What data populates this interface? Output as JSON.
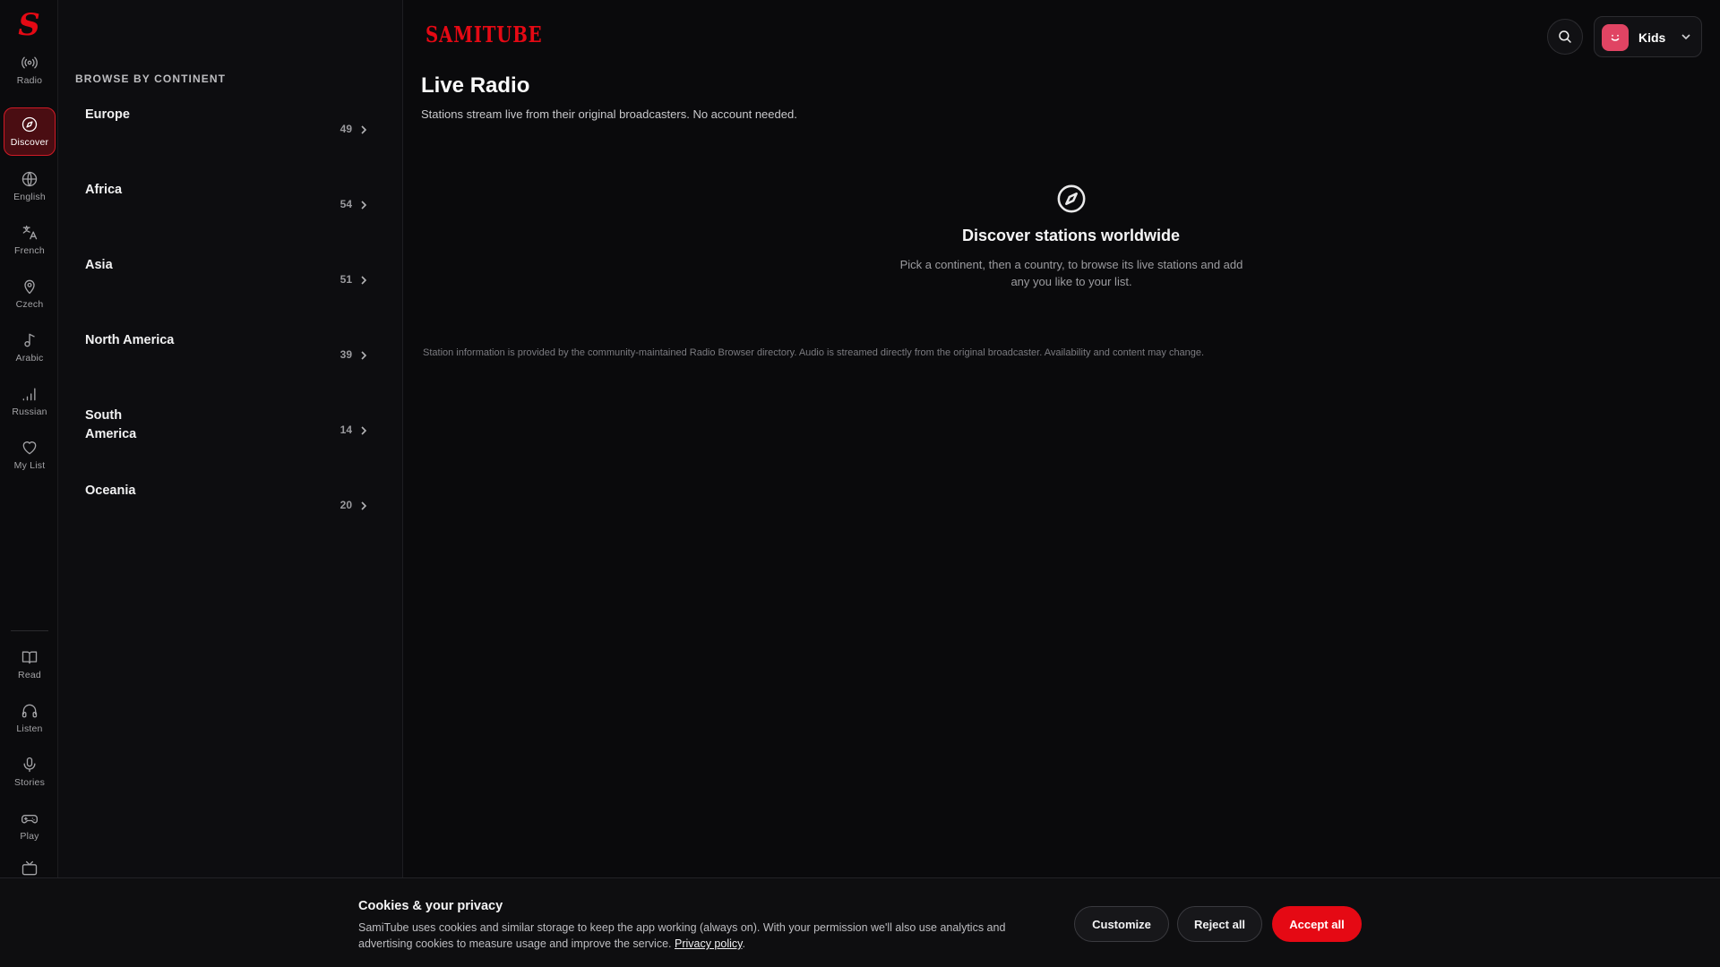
{
  "rail": {
    "logo": "S",
    "items": [
      {
        "label": "Radio",
        "icon": "radio-broadcast-icon"
      },
      {
        "label": "Discover",
        "icon": "compass-icon"
      },
      {
        "label": "English",
        "icon": "globe-icon"
      },
      {
        "label": "French",
        "icon": "translate-icon"
      },
      {
        "label": "Czech",
        "icon": "map-pin-icon"
      },
      {
        "label": "Arabic",
        "icon": "music-note-icon"
      },
      {
        "label": "Russian",
        "icon": "signal-bars-icon"
      },
      {
        "label": "My List",
        "icon": "heart-icon"
      },
      {
        "label": "Read",
        "icon": "book-icon"
      },
      {
        "label": "Listen",
        "icon": "headphones-icon"
      },
      {
        "label": "Stories",
        "icon": "microphone-icon"
      },
      {
        "label": "Play",
        "icon": "gamepad-icon"
      }
    ],
    "active": "Discover"
  },
  "panel": {
    "title": "BROWSE BY CONTINENT",
    "continents": [
      {
        "name": "Europe",
        "count": "49"
      },
      {
        "name": "Africa",
        "count": "54"
      },
      {
        "name": "Asia",
        "count": "51"
      },
      {
        "name": "North America",
        "count": "39"
      },
      {
        "name": "South America",
        "count": "14"
      },
      {
        "name": "Oceania",
        "count": "20"
      }
    ]
  },
  "header": {
    "brand": "SAMITUBE",
    "profile_name": "Kids"
  },
  "main": {
    "title": "Live Radio",
    "subtitle": "Stations stream live from their original broadcasters. No account needed.",
    "empty_title": "Discover stations worldwide",
    "empty_desc": "Pick a continent, then a country, to browse its live stations and add any you like to your list.",
    "footnote": "Station information is provided by the community-maintained Radio Browser directory. Audio is streamed directly from the original broadcaster. Availability and content may change."
  },
  "cookie": {
    "title": "Cookies & your privacy",
    "text": "SamiTube uses cookies and similar storage to keep the app working (always on). With your permission we'll also use analytics and advertising cookies to measure usage and improve the service.",
    "link": "Privacy policy",
    "customize": "Customize",
    "reject": "Reject all",
    "accept": "Accept all"
  },
  "colors": {
    "accent": "#e50914",
    "avatar": "#e04463"
  }
}
